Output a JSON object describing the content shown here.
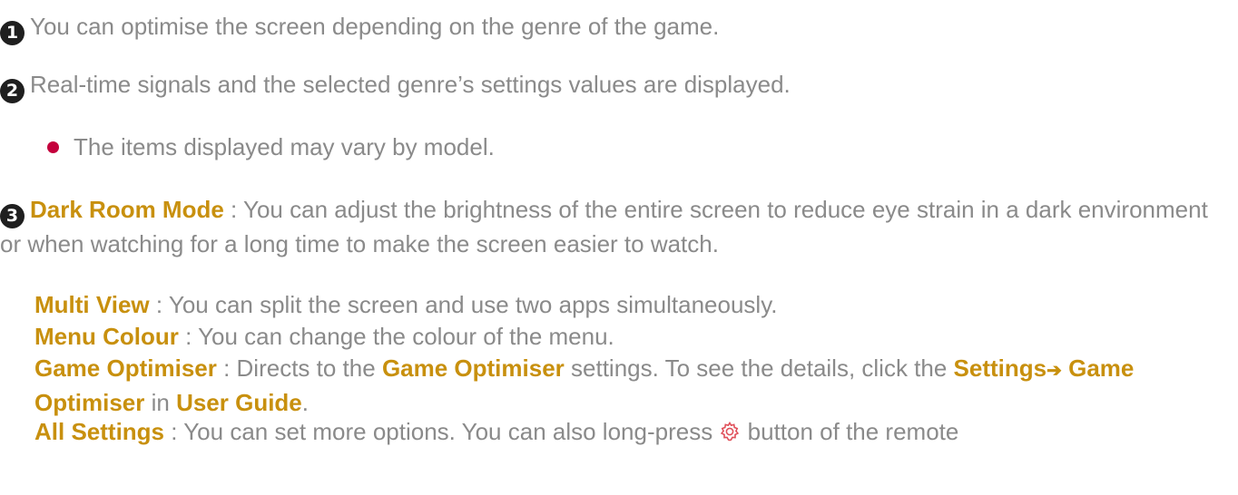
{
  "items": [
    {
      "marker": "1",
      "text": "You can optimise the screen depending on the genre of the game."
    },
    {
      "marker": "2",
      "text": "Real-time signals and the selected genre’s settings values are displayed."
    }
  ],
  "bullet": {
    "text": "The items displayed may vary by model."
  },
  "item3": {
    "marker": "3",
    "dark_room": {
      "label": "Dark Room Mode",
      "text": " : You can adjust the brightness of the entire screen to reduce eye strain in a dark environment or when watching for a long time to make the screen easier to watch."
    },
    "multi_view": {
      "label": "Multi View",
      "text": " : You can split the screen and use two apps simultaneously."
    },
    "menu_colour": {
      "label": "Menu Colour",
      "text": " : You can change the colour of the menu."
    },
    "game_optimiser": {
      "label": "Game Optimiser",
      "text1": " : Directs to the ",
      "link1": "Game Optimiser",
      "text2": " settings. To see the details, click the ",
      "link2": "Settings",
      "arrow": "➔",
      "link3": "Game Optimiser",
      "text3": " in ",
      "link4": "User Guide",
      "text4": "."
    },
    "all_settings": {
      "label": "All Settings",
      "text1": " : You can set more options. You can also long-press ",
      "icon": "settings-gear-icon",
      "text2": " button of the remote"
    }
  },
  "colors": {
    "text": "#8a8a8a",
    "highlight": "#c8900e",
    "bullet": "#c4003c",
    "marker_bg": "#1f1f1f",
    "gear": "#e0505a"
  }
}
